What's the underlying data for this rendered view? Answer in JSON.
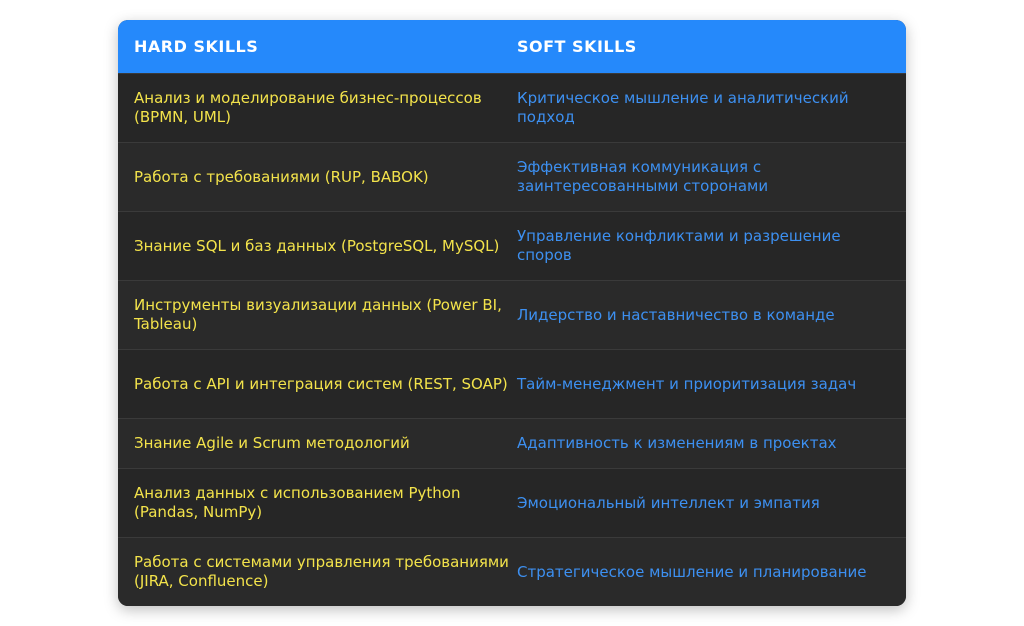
{
  "header": {
    "hard_label": "HARD SKILLS",
    "soft_label": "SOFT SKILLS"
  },
  "rows": [
    {
      "hard": "Анализ и моделирование бизнес-процессов (BPMN, UML)",
      "soft": "Критическое мышление и аналитический подход"
    },
    {
      "hard": "Работа с требованиями (RUP, BABOK)",
      "soft": "Эффективная коммуникация с заинтересованными сторонами"
    },
    {
      "hard": "Знание SQL и баз данных (PostgreSQL, MySQL)",
      "soft": "Управление конфликтами и разрешение споров"
    },
    {
      "hard": "Инструменты визуализации данных (Power BI, Tableau)",
      "soft": "Лидерство и наставничество в команде"
    },
    {
      "hard": "Работа с API и интеграция систем (REST, SOAP)",
      "soft": "Тайм-менеджмент и приоритизация задач"
    },
    {
      "hard": "Знание Agile и Scrum методологий",
      "soft": "Адаптивность к изменениям в проектах"
    },
    {
      "hard": "Анализ данных с использованием Python (Pandas, NumPy)",
      "soft": "Эмоциональный интеллект и эмпатия"
    },
    {
      "hard": "Работа с системами управления требованиями (JIRA, Confluence)",
      "soft": "Стратегическое мышление и планирование"
    }
  ],
  "colors": {
    "header_bg": "#2589fb",
    "hard_text": "#f3e34b",
    "soft_text": "#3d90f1",
    "table_bg": "#282828"
  }
}
